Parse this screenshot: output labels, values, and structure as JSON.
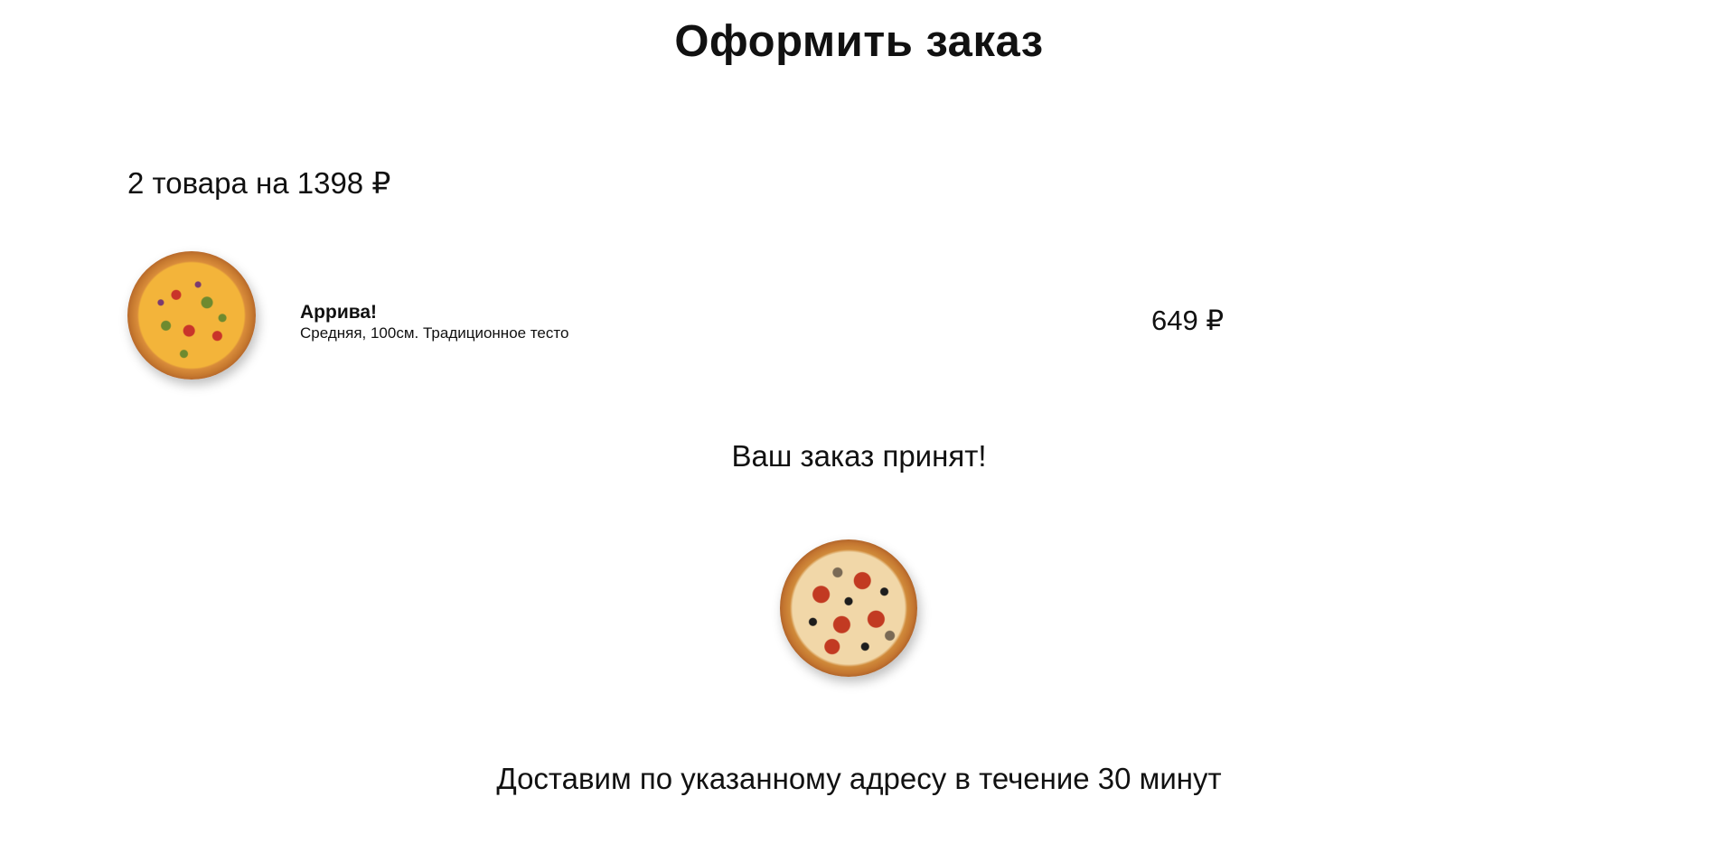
{
  "page": {
    "title": "Оформить заказ"
  },
  "cart": {
    "summary": "2 товара на 1398 ₽",
    "items": [
      {
        "name": "Аррива!",
        "description": "Средняя, 100см. Традиционное тесто",
        "price": "649 ₽",
        "image_icon": "pizza-image"
      }
    ]
  },
  "confirmation": {
    "message": "Ваш заказ принят!",
    "image_icon": "pizza-image",
    "delivery_note": "Доставим по указанному адресу в течение 30 минут"
  }
}
